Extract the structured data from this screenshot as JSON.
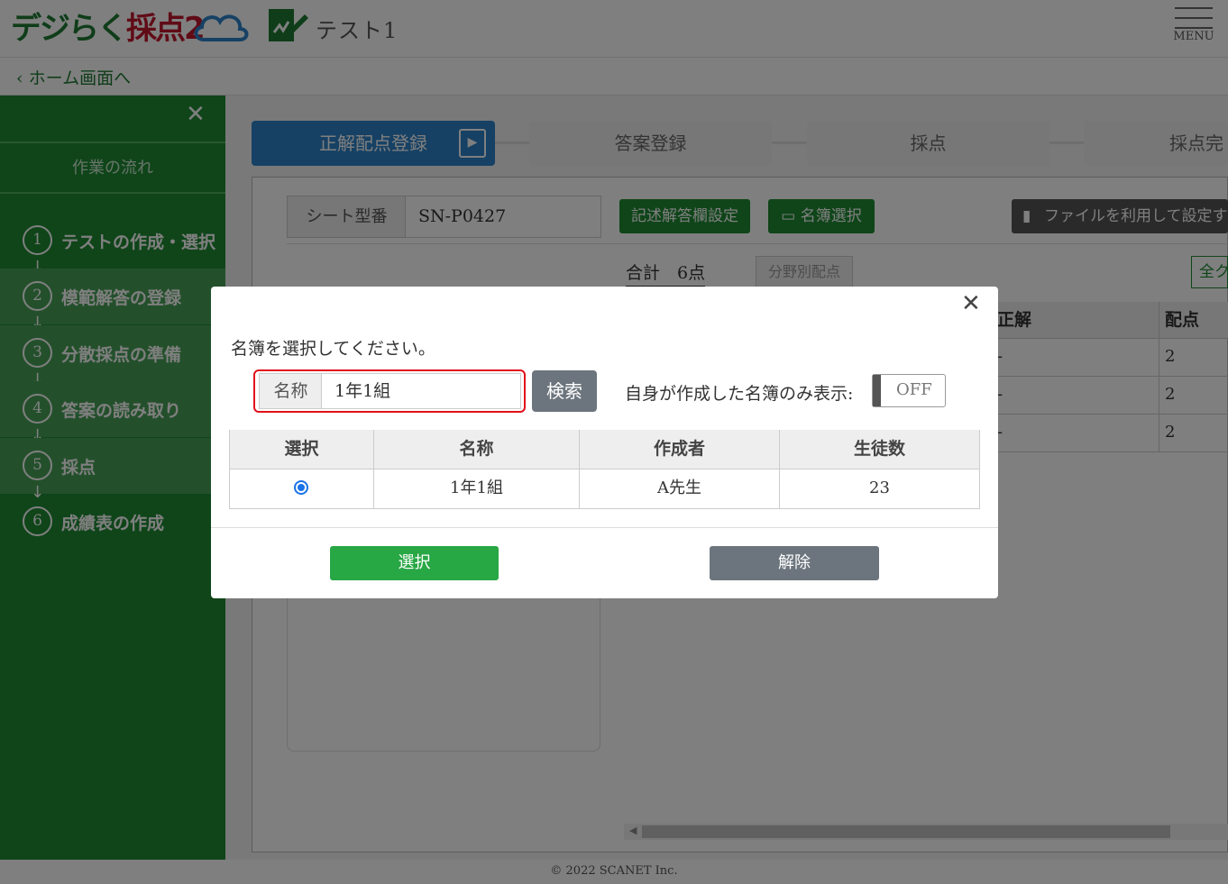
{
  "header": {
    "logo_text_green": "デジらく",
    "logo_text_red": "採点2",
    "test_name": "テスト1",
    "menu_label": "MENU"
  },
  "nav": {
    "back_label": "ホーム画面へ"
  },
  "sidebar": {
    "title": "作業の流れ",
    "steps": [
      {
        "num": "1",
        "label": "テストの作成・選択"
      },
      {
        "num": "2",
        "label": "模範解答の登録"
      },
      {
        "num": "3",
        "label": "分散採点の準備"
      },
      {
        "num": "4",
        "label": "答案の読み取り"
      },
      {
        "num": "5",
        "label": "採点"
      },
      {
        "num": "6",
        "label": "成績表の作成"
      }
    ]
  },
  "tabs": [
    "正解配点登録",
    "答案登録",
    "採点",
    "採点完"
  ],
  "main": {
    "sheet_label": "シート型番",
    "sheet_value": "SN-P0427",
    "btn_descriptive": "記述解答欄設定",
    "btn_roster": "名簿選択",
    "btn_file": "ファイルを利用して設定す",
    "total": "合計　6点",
    "btn_field_points": "分野別配点",
    "btn_all": "全ク",
    "table": {
      "headers": [
        "正解",
        "配点"
      ],
      "rows": [
        [
          "-",
          "2"
        ],
        [
          "-",
          "2"
        ],
        [
          "-",
          "2"
        ]
      ]
    }
  },
  "footer": "© 2022 SCANET Inc.",
  "modal": {
    "prompt": "名簿を選択してください。",
    "search_label": "名称",
    "search_value": "1年1組",
    "search_button": "検索",
    "own_only_label": "自身が作成した名簿のみ表示:",
    "toggle_value": "OFF",
    "columns": [
      "選択",
      "名称",
      "作成者",
      "生徒数"
    ],
    "rows": [
      {
        "name": "1年1組",
        "creator": "A先生",
        "students": "23"
      }
    ],
    "select_button": "選択",
    "release_button": "解除"
  },
  "colors": {
    "sidebar_green": "#1f8b33",
    "active_tab": "#2d83c9",
    "select_green": "#28a745",
    "highlight_red": "#e0101a"
  }
}
